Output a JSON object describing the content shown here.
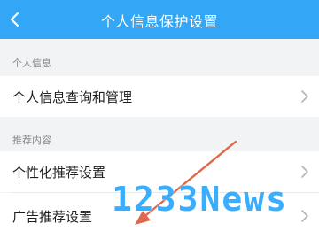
{
  "header": {
    "title": "个人信息保护设置",
    "back_icon": "chevron-left-icon"
  },
  "sections": [
    {
      "label": "个人信息",
      "items": [
        {
          "label": "个人信息查询和管理",
          "icon": "chevron-right-icon"
        }
      ]
    },
    {
      "label": "推荐内容",
      "items": [
        {
          "label": "个性化推荐设置",
          "icon": "chevron-right-icon"
        },
        {
          "label": "广告推荐设置",
          "icon": "chevron-right-icon"
        }
      ]
    }
  ],
  "watermark": "1233News",
  "colors": {
    "header": "#33a6f5",
    "background": "#f2f3f5",
    "annotation_arrow": "#e0684a",
    "watermark": "#16a0ff"
  }
}
